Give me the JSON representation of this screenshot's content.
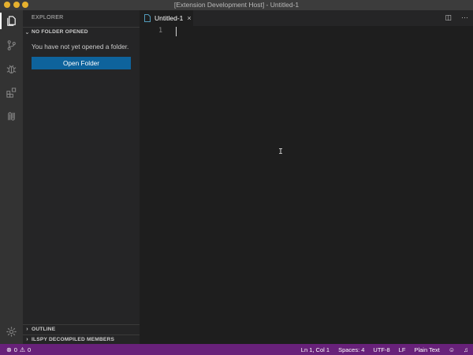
{
  "window": {
    "title": "[Extension Development Host] - Untitled-1"
  },
  "activity_bar": {
    "items": [
      {
        "name": "explorer",
        "icon": "files-icon"
      },
      {
        "name": "source-control",
        "icon": "source-control-icon"
      },
      {
        "name": "debug",
        "icon": "bug-icon"
      },
      {
        "name": "extensions",
        "icon": "extensions-icon"
      },
      {
        "name": "remote",
        "icon": "remote-icon"
      }
    ],
    "settings_icon": "gear-icon"
  },
  "sidebar": {
    "header": "EXPLORER",
    "no_folder_section": "NO FOLDER OPENED",
    "message": "You have not yet opened a folder.",
    "open_folder_button": "Open Folder",
    "outline_section": "OUTLINE",
    "ilspy_section": "ILSPY DECOMPILED MEMBERS"
  },
  "editor": {
    "tab_label": "Untitled-1",
    "tab_close": "×",
    "line_number": "1"
  },
  "status_bar": {
    "errors": "0",
    "warnings": "0",
    "position": "Ln 1, Col 1",
    "spaces": "Spaces: 4",
    "encoding": "UTF-8",
    "eol": "LF",
    "language": "Plain Text"
  },
  "colors": {
    "status_bar": "#68217a",
    "button": "#0e639c",
    "activity_bar": "#333333",
    "sidebar": "#252526",
    "editor": "#1e1e1e"
  }
}
